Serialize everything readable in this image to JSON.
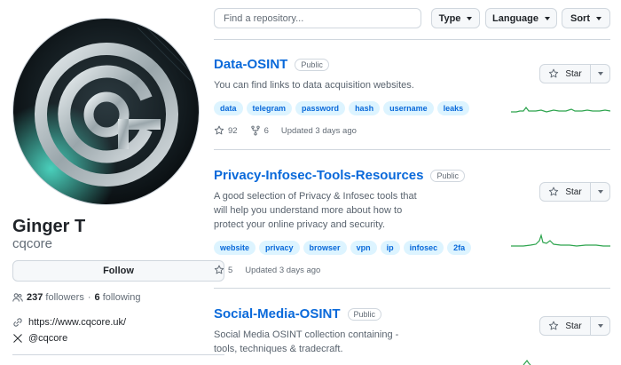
{
  "profile": {
    "name": "Ginger T",
    "login": "cqcore",
    "follow_label": "Follow",
    "followers_count": "237",
    "followers_label": "followers",
    "separator": "·",
    "following_count": "6",
    "following_label": "following",
    "website": "https://www.cqcore.uk/",
    "social_handle": "@cqcore"
  },
  "filters": {
    "search_placeholder": "Find a repository...",
    "type_label": "Type",
    "language_label": "Language",
    "sort_label": "Sort"
  },
  "repos": [
    {
      "name": "Data-OSINT",
      "visibility": "Public",
      "description": "You can find links to data acquisition websites.",
      "topics": [
        "data",
        "telegram",
        "password",
        "hash",
        "username",
        "leaks"
      ],
      "stars": "92",
      "forks": "6",
      "updated": "Updated 3 days ago",
      "star_label": "Star"
    },
    {
      "name": "Privacy-Infosec-Tools-Resources",
      "visibility": "Public",
      "description": "A good selection of Privacy & Infosec tools that will help you understand more about how to protect your online privacy and security.",
      "topics": [
        "website",
        "privacy",
        "browser",
        "vpn",
        "ip",
        "infosec",
        "2fa"
      ],
      "stars": "5",
      "updated": "Updated 3 days ago",
      "star_label": "Star"
    },
    {
      "name": "Social-Media-OSINT",
      "visibility": "Public",
      "description": "Social Media OSINT collection containing - tools, techniques & tradecraft.",
      "star_label": "Star"
    }
  ],
  "icons": {
    "followers": "people-icon",
    "website": "link-icon",
    "social": "x-logo-icon",
    "star": "star-icon",
    "fork": "fork-icon"
  },
  "colors": {
    "link": "#0969da",
    "topic_bg": "#ddf4ff",
    "sparkline": "#2da44e",
    "border": "#d0d7de",
    "muted": "#636c76"
  }
}
